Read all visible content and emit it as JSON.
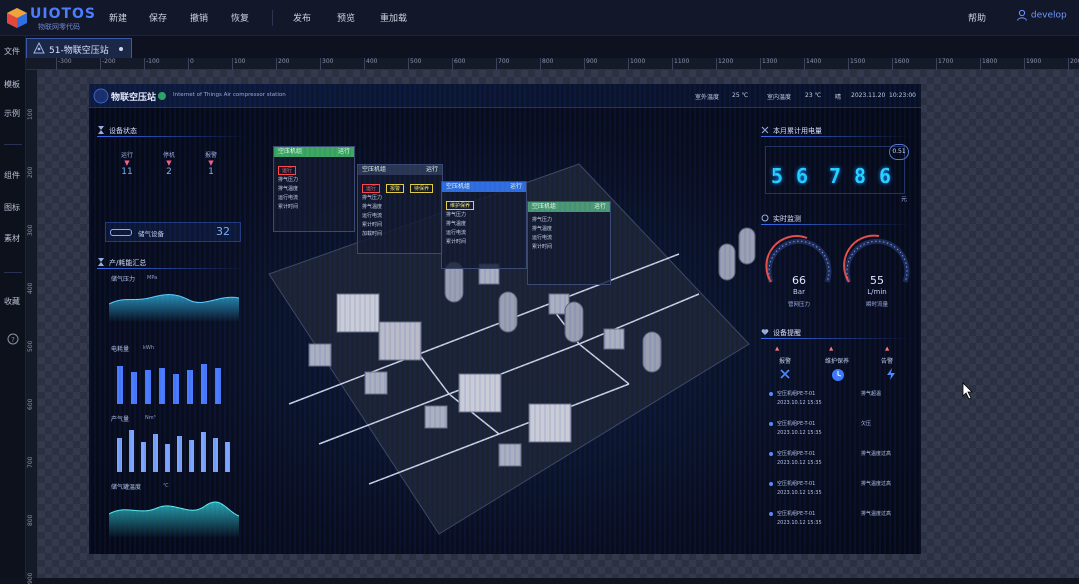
{
  "app": {
    "logo_title": "UIOTOS",
    "logo_subtitle": "物联网零代码",
    "menu": [
      "新建",
      "保存",
      "撤销",
      "恢复",
      "发布",
      "预览",
      "重加载"
    ],
    "help_label": "帮助",
    "user": "develop"
  },
  "tab": {
    "label": "51-物联空压站"
  },
  "left_nav": [
    "文件",
    "模板",
    "示例",
    "组件",
    "图标",
    "素材",
    "收藏"
  ],
  "ruler": {
    "h_ticks": [
      "-300",
      "-200",
      "-100",
      "0",
      "100",
      "200",
      "300",
      "400",
      "500",
      "600",
      "700",
      "800",
      "900",
      "1000",
      "1100",
      "1200",
      "1300",
      "1400",
      "1500",
      "1600",
      "1700",
      "1800",
      "1900",
      "2000"
    ],
    "v_ticks": [
      "100",
      "200",
      "300",
      "400",
      "500",
      "600",
      "700",
      "800",
      "900"
    ]
  },
  "screen": {
    "title": "物联空压站",
    "subtitle": "Internet of Things Air compressor station",
    "weather": [
      "室外温度",
      "25 ℃",
      "室内温度",
      "23 ℃",
      "晴",
      "2023.11.20",
      "10:23:00"
    ],
    "left": {
      "device_status_title": "设备状态",
      "stats": [
        {
          "label": "运行",
          "value": "11"
        },
        {
          "label": "停机",
          "value": "2"
        },
        {
          "label": "报警",
          "value": "1"
        }
      ],
      "tank_label": "储气设备",
      "tank_value": "32",
      "energy_title": "产/耗能汇总",
      "charts": [
        {
          "label": "储气压力",
          "unit": "MPa"
        },
        {
          "label": "电耗量",
          "unit": "kWh"
        },
        {
          "label": "产气量",
          "unit": "Nm³"
        },
        {
          "label": "储气罐温度",
          "unit": "℃"
        }
      ]
    },
    "panels": [
      {
        "header": "空压机组",
        "status": "运行",
        "tags": [
          "运行"
        ],
        "rows": [
          "排气压力",
          "排气温度",
          "运行电流",
          "累计时间"
        ]
      },
      {
        "header": "空压机组",
        "status": "运行",
        "tags": [
          "运行",
          "报警",
          "待保养"
        ],
        "rows": [
          "排气压力",
          "排气温度",
          "运行电流",
          "累计时间",
          "加载时间"
        ]
      },
      {
        "header": "空压机组",
        "status": "运行",
        "tags": [
          "维护保养"
        ],
        "rows": [
          "排气压力",
          "排气温度",
          "运行电流",
          "累计时间"
        ]
      },
      {
        "header": "空压机组",
        "status": "运行",
        "tags": [],
        "rows": [
          "排气压力",
          "排气温度",
          "运行电流",
          "累计时间"
        ]
      }
    ],
    "right": {
      "meter_title": "本月累计用电量",
      "meter_digits": [
        "5",
        "6",
        "7",
        "8",
        "6"
      ],
      "meter_unit": "元",
      "meter_badge": "0.51",
      "realtime_title": "实时监测",
      "gauges": [
        {
          "value": 66,
          "unit": "Bar",
          "label": "管网压力",
          "fraction": 0.66
        },
        {
          "value": 55,
          "unit": "L/min",
          "label": "瞬时流量",
          "fraction": 0.55
        }
      ],
      "events_title": "设备提醒",
      "event_tabs": [
        "报警",
        "维护保养",
        "告警"
      ],
      "events": [
        {
          "time": "2023.10.12  15:35",
          "device": "空压机组PE-T-01",
          "msg": "排气超温"
        },
        {
          "time": "2023.10.12  15:35",
          "device": "空压机组PE-T-01",
          "msg": "欠压"
        },
        {
          "time": "2023.10.12  15:35",
          "device": "空压机组PE-T-01",
          "msg": "排气温度过高"
        },
        {
          "time": "2023.10.12  15:35",
          "device": "空压机组PE-T-01",
          "msg": "排气温度过高"
        },
        {
          "time": "2023.10.12  15:35",
          "device": "空压机组PE-T-01",
          "msg": "排气温度过高"
        }
      ]
    }
  },
  "colors": {
    "accent": "#3a6cf0",
    "brand": "#4c7dff",
    "digit": "#25d4ff",
    "alarm": "#ff5d8a",
    "ok": "#3ca860"
  }
}
